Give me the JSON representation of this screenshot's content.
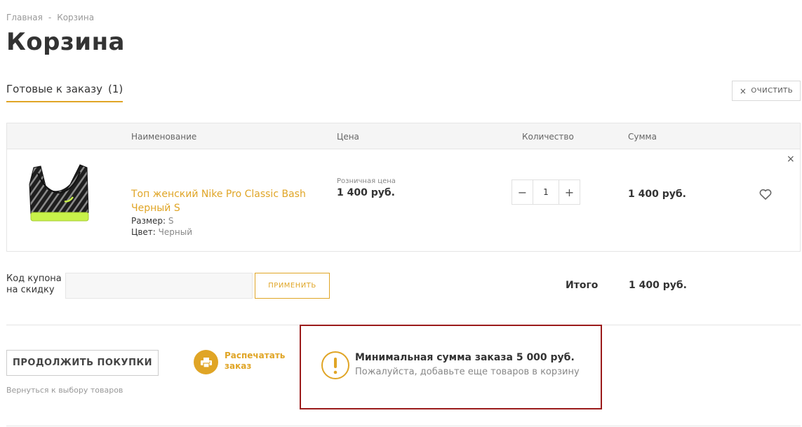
{
  "breadcrumb": {
    "home": "Главная",
    "separator": "-",
    "current": "Корзина"
  },
  "page": {
    "title": "Корзина"
  },
  "tabs": {
    "ready_label": "Готовые к заказу",
    "ready_count": "(1)"
  },
  "toolbar": {
    "clear_label": "ОЧИСТИТЬ",
    "clear_icon": "×"
  },
  "table": {
    "headers": {
      "name": "Наименование",
      "price": "Цена",
      "quantity": "Количество",
      "sum": "Сумма"
    }
  },
  "item": {
    "name": "Топ женский Nike Pro Classic Bash Черный S",
    "size_label": "Размер:",
    "size_value": "S",
    "color_label": "Цвет:",
    "color_value": "Черный",
    "price_label": "Розничная цена",
    "price": "1 400 руб.",
    "quantity": "1",
    "sum": "1 400 руб.",
    "minus": "−",
    "plus": "+",
    "remove": "×"
  },
  "coupon": {
    "label": "Код купона на скидку",
    "value": "",
    "apply_label": "ПРИМЕНИТЬ"
  },
  "total": {
    "label": "Итого",
    "value": "1 400 руб."
  },
  "actions": {
    "continue_label": "ПРОДОЛЖИТЬ ПОКУПКИ",
    "back_link": "Вернуться к выбору товаров",
    "print_label": "Распечатать заказ"
  },
  "notice": {
    "title": "Минимальная сумма заказа 5 000 руб.",
    "text": "Пожалуйста, добавьте еще товаров в корзину"
  },
  "colors": {
    "accent": "#e0a526",
    "alert_border": "#9b1b1b",
    "text": "#333333",
    "muted": "#888888"
  }
}
